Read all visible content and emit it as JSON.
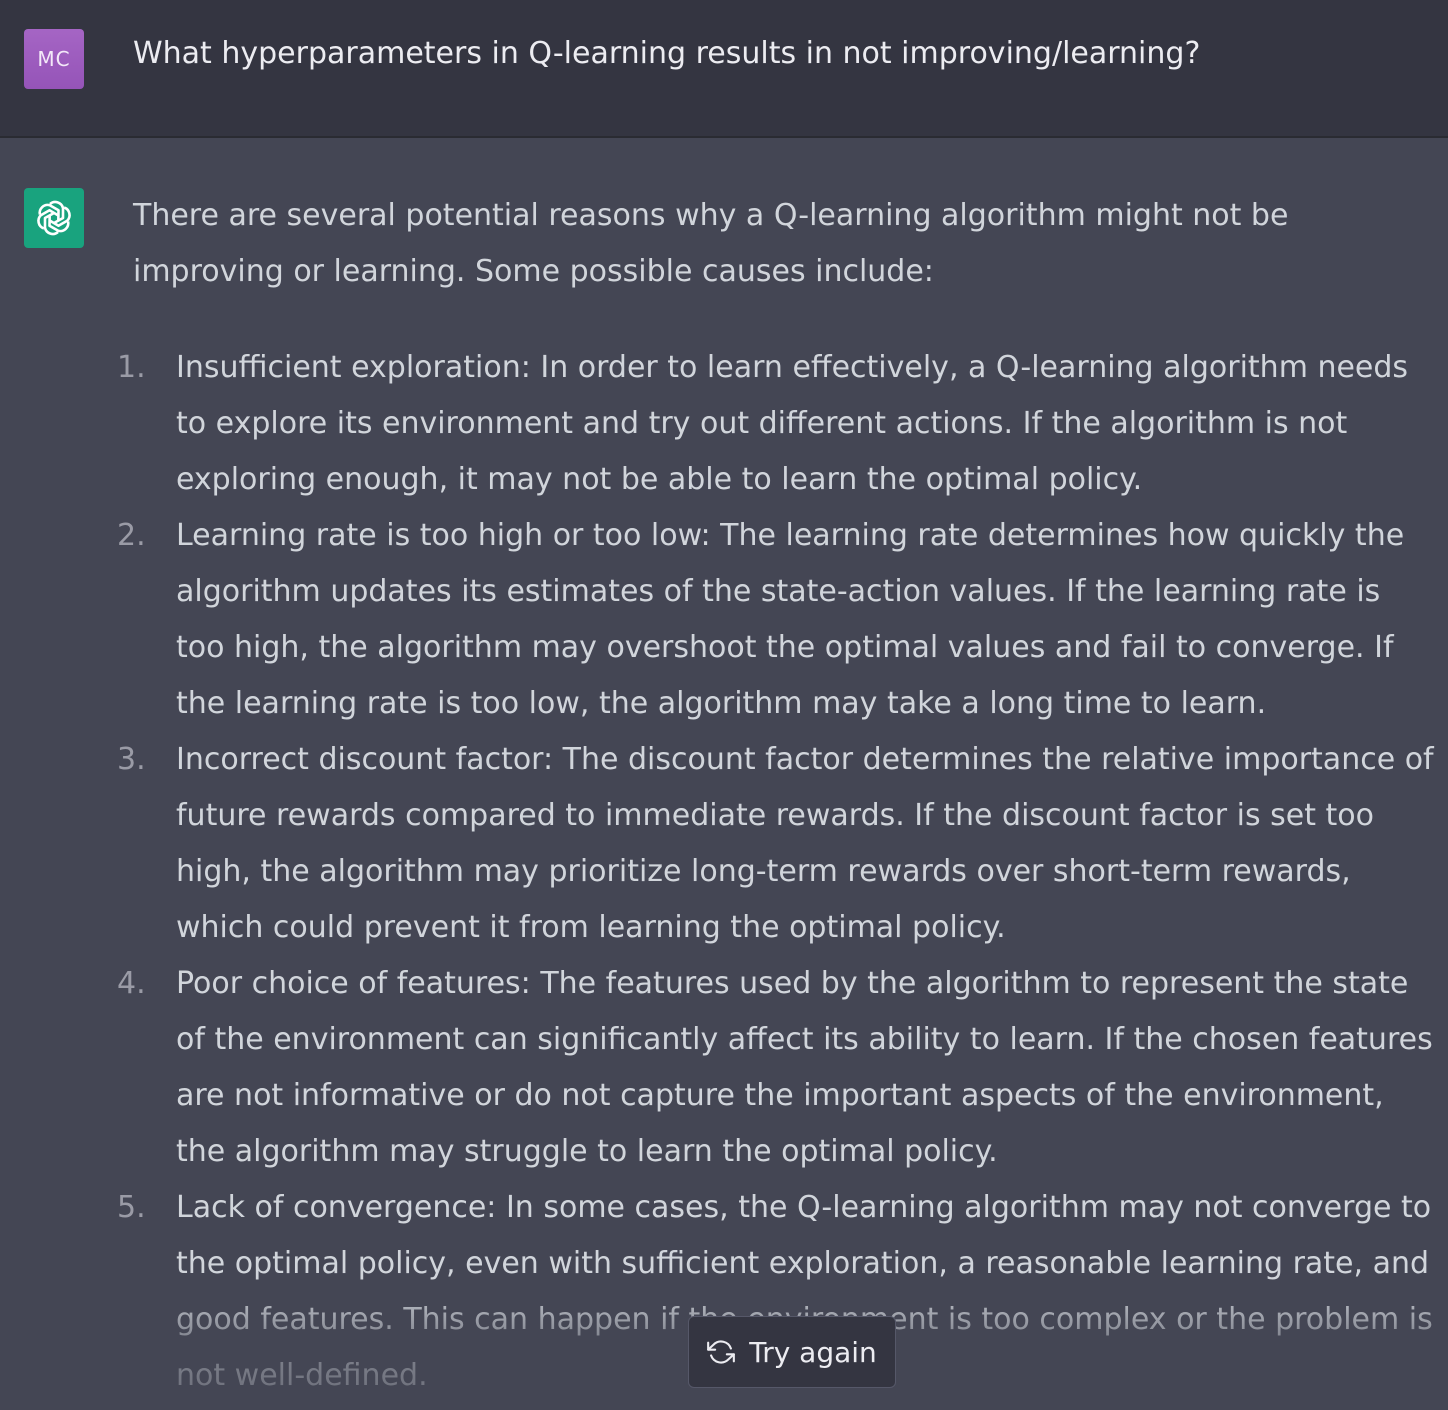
{
  "user_message": {
    "avatar_initials": "MC",
    "text": "What hyperparameters in Q-learning results in not improving/learning?"
  },
  "assistant_message": {
    "avatar_icon": "openai-logo-icon",
    "intro": "There are several potential reasons why a Q-learning algorithm might not be improving or learning. Some possible causes include:",
    "items": [
      {
        "num": "1.",
        "text": "Insufficient exploration: In order to learn effectively, a Q-learning algorithm needs to explore its environment and try out different actions. If the algorithm is not exploring enough, it may not be able to learn the optimal policy."
      },
      {
        "num": "2.",
        "text": "Learning rate is too high or too low: The learning rate determines how quickly the algorithm updates its estimates of the state-action values. If the learning rate is too high, the algorithm may overshoot the optimal values and fail to converge. If the learning rate is too low, the algorithm may take a long time to learn."
      },
      {
        "num": "3.",
        "text": "Incorrect discount factor: The discount factor determines the relative importance of future rewards compared to immediate rewards. If the discount factor is set too high, the algorithm may prioritize long-term rewards over short-term rewards, which could prevent it from learning the optimal policy."
      },
      {
        "num": "4.",
        "text": "Poor choice of features: The features used by the algorithm to represent the state of the environment can significantly affect its ability to learn. If the chosen features are not informative or do not capture the important aspects of the environment, the algorithm may struggle to learn the optimal policy."
      },
      {
        "num": "5.",
        "text": "Lack of convergence: In some cases, the Q-learning algorithm may not converge to the optimal policy, even with sufficient exploration, a reasonable learning rate, and good features. This can happen if the environment is too complex or the problem is not well-defined."
      }
    ]
  },
  "try_again": {
    "label": "Try again",
    "icon": "refresh-icon"
  },
  "colors": {
    "user_bg": "#343541",
    "assistant_bg": "#444654",
    "user_avatar": "#9b59b6",
    "bot_avatar": "#19a37e"
  }
}
